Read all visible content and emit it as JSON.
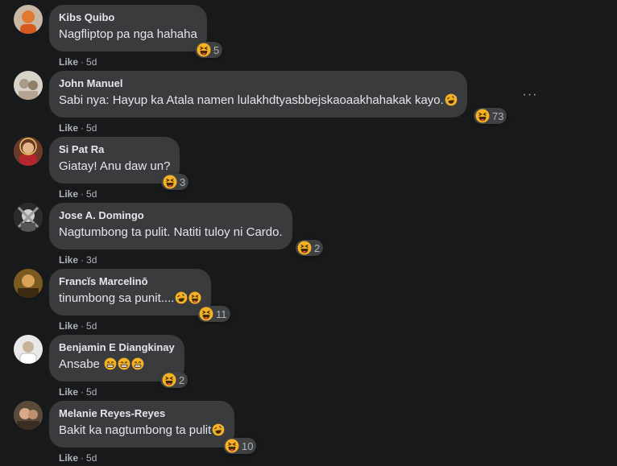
{
  "comments": [
    {
      "author": "Kibs Quibo",
      "text": "Nagfliptop pa nga hahaha",
      "reaction_count": "5",
      "like": "Like",
      "time": "5d"
    },
    {
      "author": "John Manuel",
      "text": "Sabi nya: Hayup ka Atala namen lulakhdtyasbbejskaoaakhahakak kayo.",
      "reaction_count": "73",
      "like": "Like",
      "time": "5d"
    },
    {
      "author": "Si Pat Ra",
      "text": "Giatay! Anu daw un?",
      "reaction_count": "3",
      "like": "Like",
      "time": "5d"
    },
    {
      "author": "Jose A. Domingo",
      "text": "Nagtumbong ta pulit. Natiti tuloy ni Cardo.",
      "reaction_count": "2",
      "like": "Like",
      "time": "3d"
    },
    {
      "author": "Francĭs Marcelinō",
      "text": "tinumbong sa punit....",
      "reaction_count": "11",
      "like": "Like",
      "time": "5d"
    },
    {
      "author": "Benjamin E Diangkinay",
      "text": "Ansabe",
      "reaction_count": "2",
      "like": "Like",
      "time": "5d"
    },
    {
      "author": "Melanie Reyes-Reyes",
      "text": "Bakit ka nagtumbong ta pulit",
      "reaction_count": "10",
      "like": "Like",
      "time": "5d"
    }
  ],
  "more_options": "···",
  "dot": "·",
  "colors": {
    "background": "#18191a",
    "bubble": "#3a3b3c",
    "text": "#e4e6eb",
    "secondary": "#b0b3b8",
    "haha": "#f7b125"
  },
  "icons": {
    "reaction": "haha-emoji-icon",
    "inline": [
      "laughing-emoji-icon",
      "grinning-emoji-icon"
    ],
    "more": "more-options-icon"
  }
}
